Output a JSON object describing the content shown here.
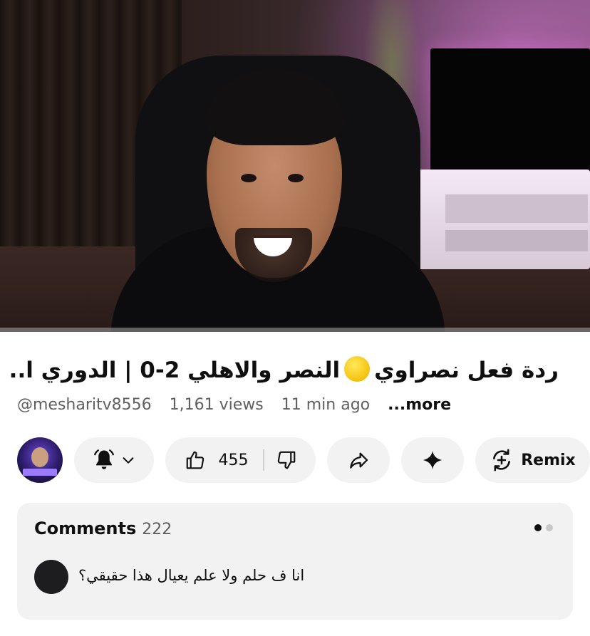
{
  "video": {
    "thumbnail_description": "man smiling in gaming chair, pink lit room with TV"
  },
  "header": {
    "title": "ردة فعل نصراوي 🟡 النصر والاهلي 2-0 | الدوري ا...",
    "title_parts": [
      "ردة فعل نصراوي",
      "النصر والاهلي 2-0 | الدوري ا..."
    ]
  },
  "meta": {
    "channel": "@mesharitv8556",
    "views": "1,161 views",
    "time_ago": "11 min ago",
    "more_label": "...more"
  },
  "actions": {
    "bell_icon": "bell-icon",
    "like_icon": "thumbs-up-icon",
    "like_count": "455",
    "dislike_icon": "thumbs-down-icon",
    "share_icon": "share-icon",
    "spark_icon": "sparkle-icon",
    "remix_icon": "remix-icon",
    "remix_label": "Remix"
  },
  "comments": {
    "heading": "Comments",
    "count": "222",
    "top_comment": "انا ف حلم ولا علم يعيال هذا حقيقي؟"
  },
  "colors": {
    "pill_bg": "#f2f2f2",
    "text_primary": "#0f0f0f",
    "text_secondary": "#606060"
  }
}
